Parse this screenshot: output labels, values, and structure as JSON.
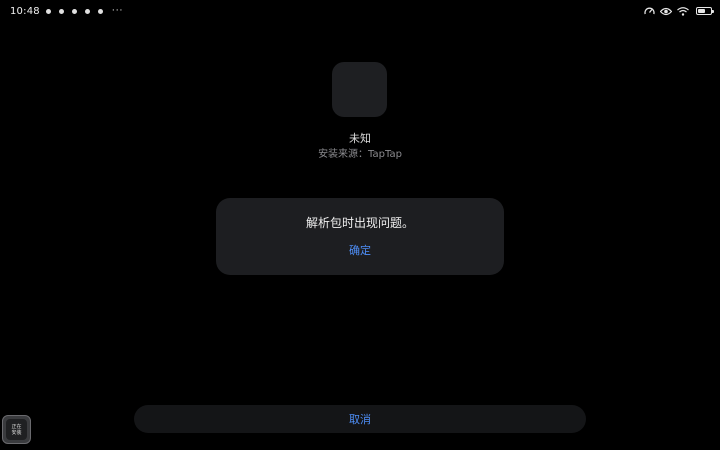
{
  "status_bar": {
    "time": "10:48",
    "notification_icons": [
      "notification-icon",
      "notification-icon",
      "notification-icon",
      "notification-icon",
      "notification-icon"
    ],
    "more": "···",
    "right_icons": [
      "speed-gauge-icon",
      "eye-icon",
      "wifi-icon",
      "battery-icon"
    ],
    "battery_level": 0.55
  },
  "app": {
    "name": "未知",
    "install_source": "安装来源：TapTap"
  },
  "dialog": {
    "message": "解析包时出现问题。",
    "confirm_label": "确定"
  },
  "bottom": {
    "cancel_label": "取消"
  },
  "floating_badge": {
    "line1": "正在",
    "line2": "安装"
  },
  "colors": {
    "background": "#000000",
    "accent": "#4e8ef7",
    "dialog_bg": "#1d1e21"
  }
}
